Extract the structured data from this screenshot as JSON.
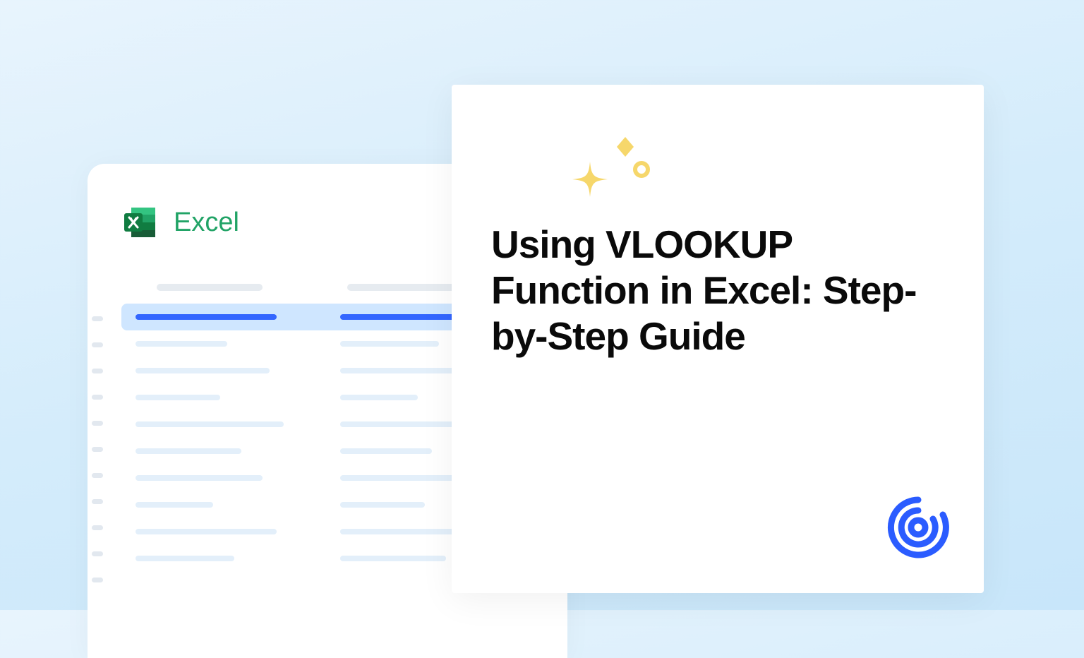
{
  "app": {
    "name": "Excel"
  },
  "card": {
    "title": "Using VLOOKUP Function in Excel: Step-by-Step Guide"
  },
  "colors": {
    "excel_green": "#21a366",
    "accent_blue": "#3366ff",
    "sparkle_yellow": "#f6d76b",
    "brand_blue": "#2b5cff"
  }
}
